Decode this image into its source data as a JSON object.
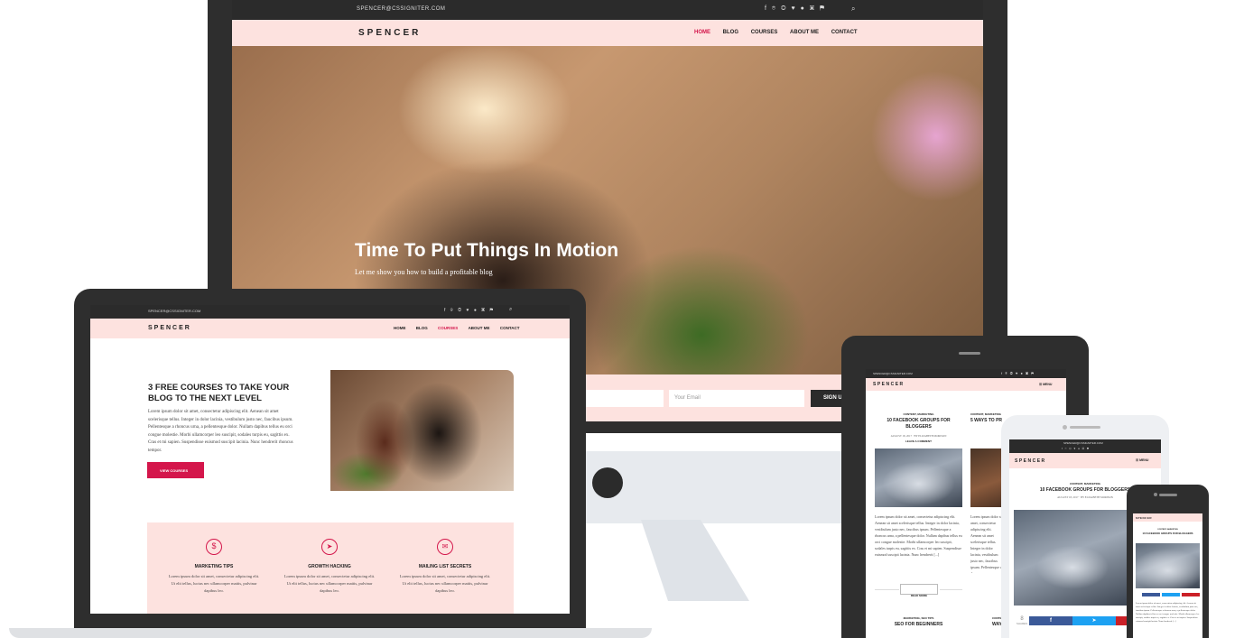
{
  "brand": {
    "logo": "SPENCER",
    "email": "SPENCER@CSSIGNITER.COM",
    "accent": "#d4164b",
    "pink": "#fde2df"
  },
  "social_icons": "f ⌾ ◎ ♥ ● ▣ ⚑",
  "nav": {
    "home": "HOME",
    "blog": "BLOG",
    "courses": "COURSES",
    "about": "ABOUT ME",
    "contact": "CONTACT",
    "menu": "☰ MENU"
  },
  "hero": {
    "title": "Time To Put Things In Motion",
    "subtitle": "Let me show you how to build a profitable blog"
  },
  "newsletter": {
    "email_placeholder": "Your Email",
    "signup": "SIGN UP"
  },
  "courses_page": {
    "heading": "3 FREE COURSES TO TAKE YOUR BLOG TO THE NEXT LEVEL",
    "body": "Lorem ipsum dolor sit amet, consectetur adipiscing elit. Aenean sit amet scelerisque tellus. Integer in dolor lacinia, vestibulum justo nec, faucibus ipsum. Pellentesque a rhoncus urna, a pellentesque dolor. Nullam dapibus tellus eu orci congue molestie. Morbi ullamcorper leo suscipit, sodales turpis eu, sagittis ex. Cras et mi sapien. Suspendisse euismod suscipit lacinia. Nunc hendrerit rhoncus tempor.",
    "button": "VIEW COURSES",
    "features": [
      {
        "title": "MARKETING TIPS",
        "text": "Lorem ipsum dolor sit amet, consectetur adipiscing elit. Ut elit tellus, luctus nec ullamcorper mattis, pulvinar dapibus leo."
      },
      {
        "title": "GROWTH HACKING",
        "text": "Lorem ipsum dolor sit amet, consectetur adipiscing elit. Ut elit tellus, luctus nec ullamcorper mattis, pulvinar dapibus leo."
      },
      {
        "title": "MAILING LIST SECRETS",
        "text": "Lorem ipsum dolor sit amet, consectetur adipiscing elit. Ut elit tellus, luctus nec ullamcorper mattis, pulvinar dapibus leo."
      }
    ]
  },
  "blog": {
    "post1_category": "CONTENT, MARKETING",
    "post1_title": "10 FACEBOOK GROUPS FOR BLOGGERS",
    "post1_meta": "AUGUST 18, 2017 · BY ELIZABETH MORISON",
    "leave_comment": "LEAVE A COMMENT",
    "post1_excerpt": "Lorem ipsum dolor sit amet, consectetur adipiscing elit. Aenean sit amet scelerisque tellus. Integer in dolor lacinia, vestibulum justo nec, faucibus ipsum. Pellentesque a rhoncus urna, a pellentesque dolor. Nullam dapibus tellus eu orci congue molestie. Morbi ullamcorper leo suscipit, sodales turpis eu, sagittis ex. Cras et mi sapien. Suspendisse euismod suscipit lacinia. Nunc hendrerit [...]",
    "read_more": "READ MORE",
    "post2_category": "CONTENT, MARKETING",
    "post2_title": "5 WAYS TO PR",
    "post3_category": "MARKETING, SEO TIPS",
    "post3_title": "SEO FOR BEGINNERS",
    "post4_category": "CONTENT",
    "post4_title": "WAYS TO CO",
    "shares_count": "8",
    "shares_label": "SHARES"
  }
}
